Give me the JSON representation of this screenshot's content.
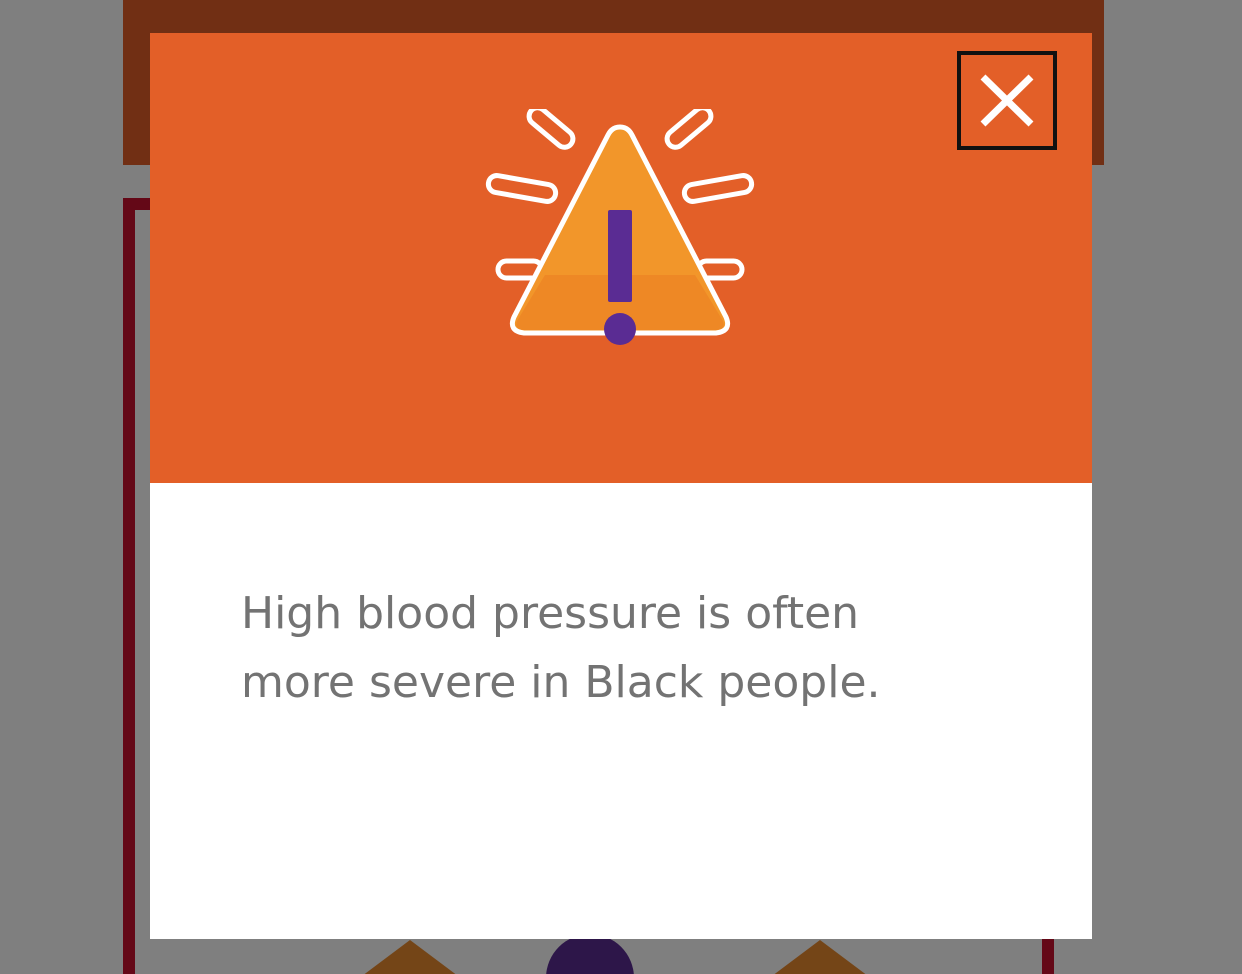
{
  "modal": {
    "message": "High blood pressure is often more severe in Black people.",
    "close_icon": "close-icon",
    "alert_icon": "warning-triangle-icon"
  },
  "colors": {
    "header_orange": "#e35f28",
    "triangle_orange": "#f2962a",
    "exclamation_purple": "#5a2c93",
    "text_gray": "#737373",
    "background_accent_red": "#c8102e"
  }
}
